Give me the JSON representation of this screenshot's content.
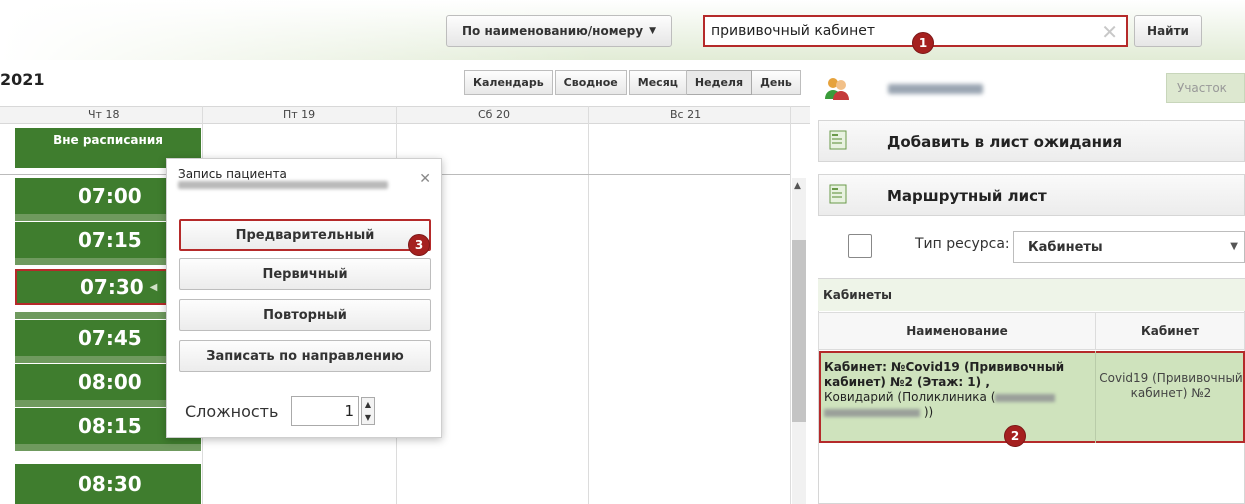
{
  "topbar": {
    "search_mode": "По наименованию/номеру",
    "search_value": "прививочный кабинет",
    "clear_icon": "✕",
    "find_label": "Найти"
  },
  "badges": {
    "b1": "1",
    "b2": "2",
    "b3": "3"
  },
  "calendar": {
    "year": "2021",
    "view_buttons": [
      "Календарь",
      "Сводное",
      "Месяц",
      "Неделя",
      "День"
    ],
    "days": [
      "Чт 18",
      "Пт 19",
      "Сб 20",
      "Вс 21"
    ],
    "outside_schedule": "Вне расписания",
    "slots": [
      "07:00",
      "07:15",
      "07:30",
      "07:45",
      "08:00",
      "08:15",
      "08:30"
    ]
  },
  "popup": {
    "title": "Запись пациента",
    "buttons": [
      "Предварительный",
      "Первичный",
      "Повторный",
      "Записать по направлению"
    ],
    "complexity_label": "Сложность",
    "complexity_value": "1"
  },
  "right_panel": {
    "uchastok_label": "Участок",
    "waitlist_label": "Добавить в лист ожидания",
    "route_label": "Маршрутный лист",
    "resource_type_label": "Тип ресурса:",
    "resource_type_value": "Кабинеты",
    "cabinets": {
      "title": "Кабинеты",
      "columns": [
        "Наименование",
        "Кабинет"
      ],
      "row": {
        "name_bold": "Кабинет: №Covid19 (Прививочный кабинет) №2 (Этаж: 1) ,",
        "name_rest": "Ковидарий (Поликлиника (",
        "name_end": "))",
        "cabinet": "Covid19 (Прививочный кабинет) №2"
      }
    }
  },
  "colors": {
    "slot_green": "#3f7d2e",
    "highlight_red": "#b52a2a",
    "selected_row": "#cfe3bd"
  }
}
